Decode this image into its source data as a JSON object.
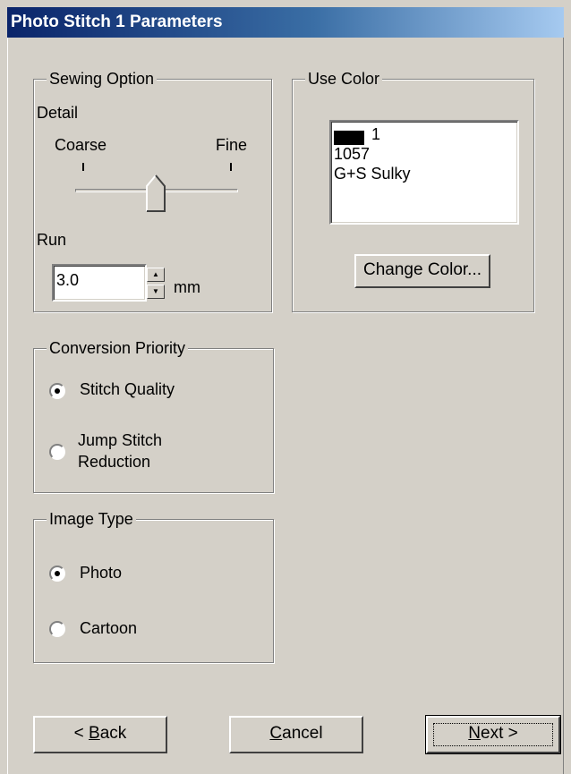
{
  "window": {
    "title": "Photo Stitch 1 Parameters"
  },
  "sewing_option": {
    "legend": "Sewing Option",
    "detail_label": "Detail",
    "coarse_label": "Coarse",
    "fine_label": "Fine",
    "detail_slider_level": 0.5,
    "run_label": "Run",
    "run_value": "3.0",
    "run_unit": "mm"
  },
  "use_color": {
    "legend": "Use Color",
    "swatch_color": "#000000",
    "color_number": "1",
    "color_code": "1057",
    "color_brand": "G+S Sulky",
    "change_button": "Change Color..."
  },
  "conversion_priority": {
    "legend": "Conversion Priority",
    "options": [
      {
        "label": "Stitch Quality",
        "selected": true
      },
      {
        "label_line1": "Jump Stitch",
        "label_line2": "Reduction",
        "selected": false
      }
    ]
  },
  "image_type": {
    "legend": "Image Type",
    "options": [
      {
        "label": "Photo",
        "selected": true
      },
      {
        "label": "Cartoon",
        "selected": false
      }
    ]
  },
  "buttons": {
    "back_prefix": "< ",
    "back_mnemonic": "B",
    "back_rest": "ack",
    "cancel_mnemonic": "C",
    "cancel_rest": "ancel",
    "next_mnemonic": "N",
    "next_rest": "ext >"
  }
}
